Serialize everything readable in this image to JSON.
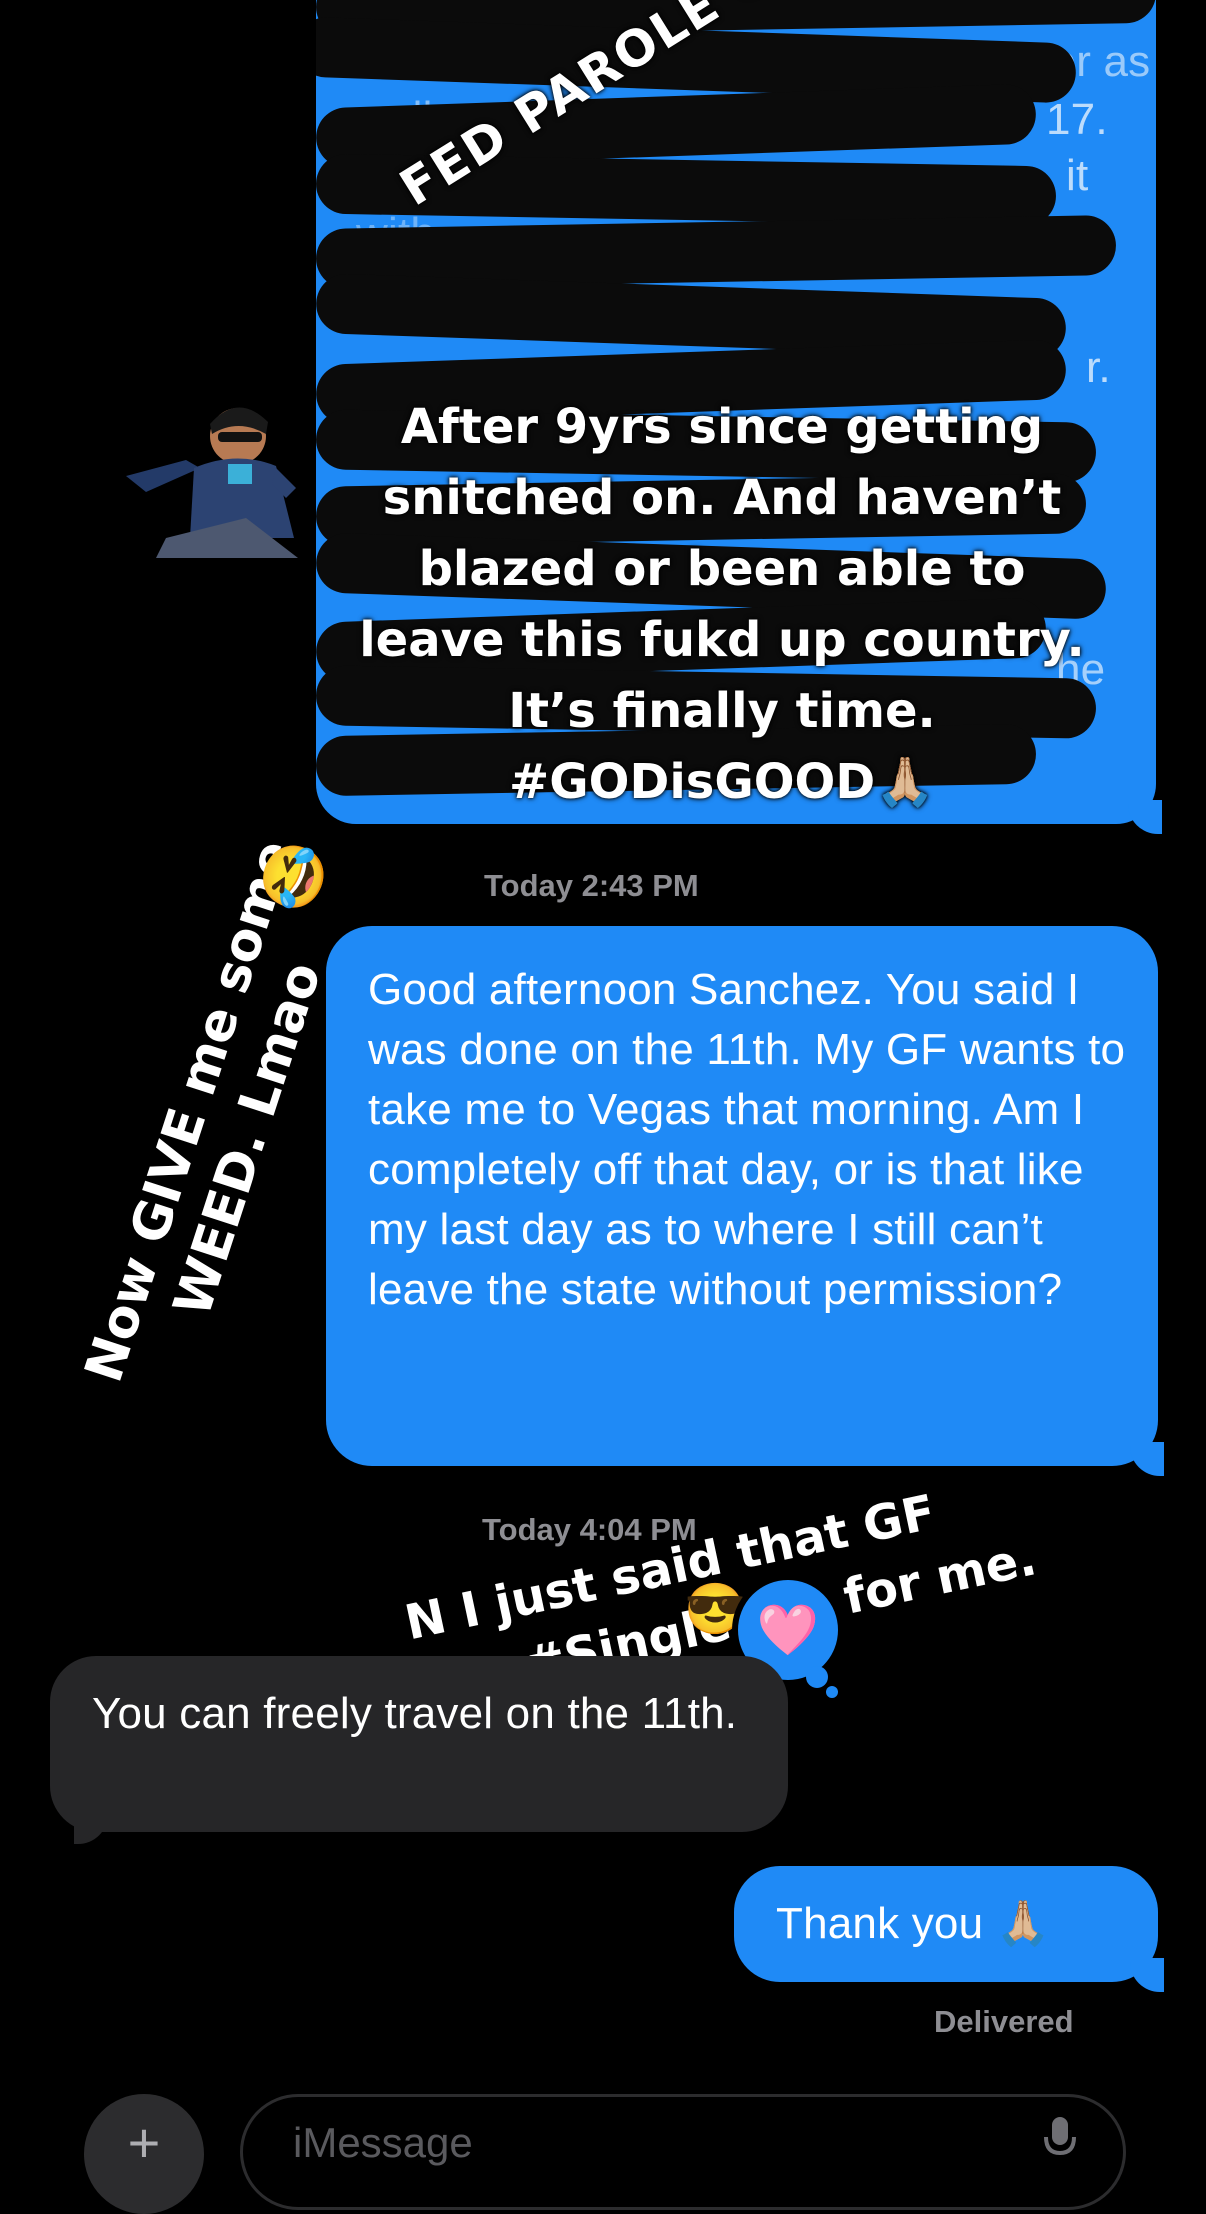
{
  "messages": {
    "first_outgoing": {
      "redacted_fragments": [
        "manager as",
        "well as $",
        "17.",
        "it",
        "with",
        "r.",
        "he"
      ]
    },
    "timestamp_1": "Today 2:43 PM",
    "second_outgoing": "Good afternoon Sanchez. You said I was done on the 11th. My GF wants to take me to Vegas that morning. Am I completely off that day, or is that like my last day as to where I still can’t leave the state without permission?",
    "timestamp_2": "Today 4:04 PM",
    "incoming_reply": "You can freely travel on the 11th.",
    "thank_you": "Thank you 🙏🏼",
    "delivered_label": "Delivered"
  },
  "overlays": {
    "fed_parole_officer": "FED PAROLE OFFICER",
    "caption_main": "After 9yrs since getting snitched on. And haven’t blazed or been able to leave this fukd up country. It’s finally time. #GODisGOOD🙏🏼",
    "side_line_1": "Now GIVE me some",
    "side_line_2": "WEED. Lmao",
    "side_emoji": "🤣",
    "gf_note_line_1": "N I just said that GF",
    "gf_note_line_2": "part. #SingleLife for me.",
    "gf_note_emoji": "😎",
    "heart_reaction": "🩷"
  },
  "composer": {
    "placeholder": "iMessage",
    "plus_symbol": "+"
  },
  "colors": {
    "outgoing_bubble": "#1f8af6",
    "incoming_bubble": "#262628",
    "background": "#000000",
    "timestamp": "#8e8e93"
  }
}
